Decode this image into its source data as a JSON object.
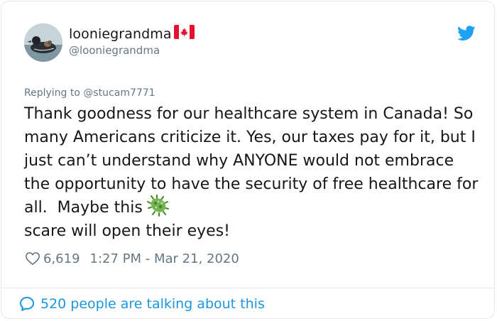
{
  "user": {
    "display_name": "looniegrandma",
    "handle": "@looniegrandma"
  },
  "reply": {
    "prefix": "Replying to ",
    "to_handle": "@stucam7771"
  },
  "tweet": {
    "text": "Thank goodness for our healthcare system in Canada! So many Americans criticize it. Yes, our taxes pay for it, but I just can’t understand why ANYONE would not embrace the opportunity to have the security of free healthcare for all.  Maybe this",
    "text_tail": "scare will open their eyes!",
    "emoji_icon": "microbe-icon"
  },
  "stats": {
    "likes": "6,619",
    "timestamp": "1:27 PM - Mar 21, 2020"
  },
  "footer": {
    "talking": "520 people are talking about this"
  },
  "colors": {
    "text": "#14171a",
    "secondary": "#657786",
    "link": "#1b95e0",
    "twitter_blue": "#1da1f2",
    "border": "#e1e8ed"
  }
}
